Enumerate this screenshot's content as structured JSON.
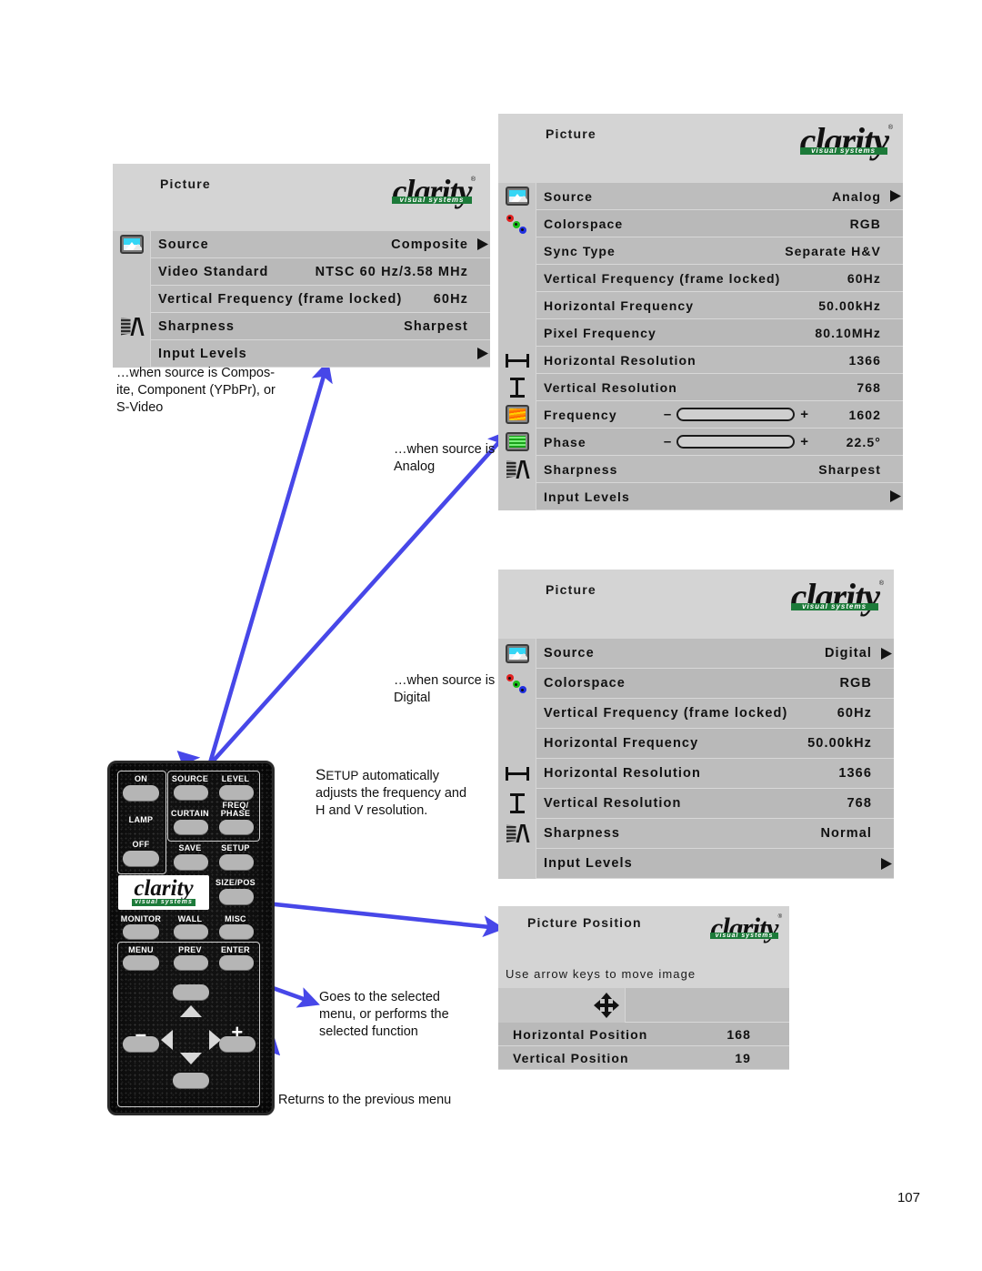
{
  "page": {
    "number": "107"
  },
  "brand": {
    "word": "clarity",
    "subtitle": "visual systems",
    "tm": "®"
  },
  "panels": {
    "composite": {
      "title": "Picture",
      "rows": [
        {
          "icon": "picture-icon",
          "label": "Source",
          "value": "Composite",
          "caret": true
        },
        {
          "icon": "none",
          "label": "Video Standard",
          "value": "NTSC 60 Hz/3.58 MHz",
          "caret": false
        },
        {
          "icon": "none",
          "label": "Vertical Frequency (frame locked)",
          "value": "60Hz",
          "caret": false
        },
        {
          "icon": "sharpness-icon",
          "label": "Sharpness",
          "value": "Sharpest",
          "caret": false
        },
        {
          "icon": "none",
          "label": "Input Levels",
          "value": "",
          "caret": true
        }
      ]
    },
    "analog": {
      "title": "Picture",
      "rows": [
        {
          "icon": "picture-icon",
          "label": "Source",
          "value": "Analog",
          "caret": true
        },
        {
          "icon": "colorspace-icon",
          "label": "Colorspace",
          "value": "RGB",
          "caret": false
        },
        {
          "icon": "none",
          "label": "Sync Type",
          "value": "Separate H&V",
          "caret": false
        },
        {
          "icon": "none",
          "label": "Vertical Frequency (frame locked)",
          "value": "60Hz",
          "caret": false
        },
        {
          "icon": "none",
          "label": "Horizontal Frequency",
          "value": "50.00kHz",
          "caret": false
        },
        {
          "icon": "none",
          "label": "Pixel Frequency",
          "value": "80.10MHz",
          "caret": false
        },
        {
          "icon": "hres-icon",
          "label": "Horizontal Resolution",
          "value": "1366",
          "caret": false
        },
        {
          "icon": "vres-icon",
          "label": "Vertical Resolution",
          "value": "768",
          "caret": false
        },
        {
          "icon": "frequency-icon",
          "label": "Frequency",
          "slider": 55,
          "minus": "–",
          "plus": "+",
          "value": "1602",
          "caret": false
        },
        {
          "icon": "phase-icon",
          "label": "Phase",
          "slider": 55,
          "minus": "–",
          "plus": "+",
          "value": "22.5°",
          "caret": false
        },
        {
          "icon": "sharpness-icon",
          "label": "Sharpness",
          "value": "Sharpest",
          "caret": false
        },
        {
          "icon": "none",
          "label": "Input Levels",
          "value": "",
          "caret": true
        }
      ]
    },
    "digital": {
      "title": "Picture",
      "rows": [
        {
          "icon": "picture-icon",
          "label": "Source",
          "value": "Digital",
          "caret": true
        },
        {
          "icon": "colorspace-icon",
          "label": "Colorspace",
          "value": "RGB",
          "caret": false
        },
        {
          "icon": "none",
          "label": "Vertical Frequency (frame locked)",
          "value": "60Hz",
          "caret": false
        },
        {
          "icon": "none",
          "label": "Horizontal Frequency",
          "value": "50.00kHz",
          "caret": false
        },
        {
          "icon": "hres-icon",
          "label": "Horizontal Resolution",
          "value": "1366",
          "caret": false
        },
        {
          "icon": "vres-icon",
          "label": "Vertical Resolution",
          "value": "768",
          "caret": false
        },
        {
          "icon": "sharpness-icon",
          "label": "Sharpness",
          "value": "Normal",
          "caret": false
        },
        {
          "icon": "none",
          "label": "Input Levels",
          "value": "",
          "caret": true
        }
      ]
    },
    "position": {
      "title": "Picture Position",
      "hint": "Use arrow keys to move image",
      "rows": [
        {
          "icon": "move-icon",
          "label": "",
          "value": ""
        },
        {
          "icon": "none",
          "label": "Horizontal Position",
          "value": "168"
        },
        {
          "icon": "none",
          "label": "Vertical Position",
          "value": "19"
        }
      ]
    }
  },
  "notes": {
    "composite": "…when source is Compos-\nite, Component (YPbPr), or\nS-Video",
    "analog": "…when source is\nAnalog",
    "digital": "…when source is\nDigital",
    "setup_lead": "S",
    "setup_small": "ETUP",
    "setup_rest": " automatically\nadjusts the frequency and\nH and V resolution.",
    "enter": "Goes to the selected\nmenu, or performs the\nselected function",
    "prev": "Returns to the previous menu"
  },
  "remote": {
    "brand_word": "clarity",
    "brand_sub": "visual systems",
    "buttons": [
      {
        "label": "ON"
      },
      {
        "label": "LAMP"
      },
      {
        "label": "OFF"
      },
      {
        "label": "SOURCE"
      },
      {
        "label": "LEVEL"
      },
      {
        "label": "CURTAIN"
      },
      {
        "label": "FREQ/\nPHASE"
      },
      {
        "label": "SAVE"
      },
      {
        "label": "SETUP"
      },
      {
        "label": "SIZE/POS"
      },
      {
        "label": "MONITOR"
      },
      {
        "label": "WALL"
      },
      {
        "label": "MISC"
      },
      {
        "label": "MENU"
      },
      {
        "label": "PREV"
      },
      {
        "label": "ENTER"
      },
      {
        "label": "–"
      },
      {
        "label": "+"
      }
    ]
  },
  "colors": {
    "osd_bg": "#bdbdbd",
    "osd_head": "#d4d4d4",
    "icon_col": "#c6c6c6",
    "arrow": "#4747e8",
    "brand_green": "#1c7a39"
  }
}
